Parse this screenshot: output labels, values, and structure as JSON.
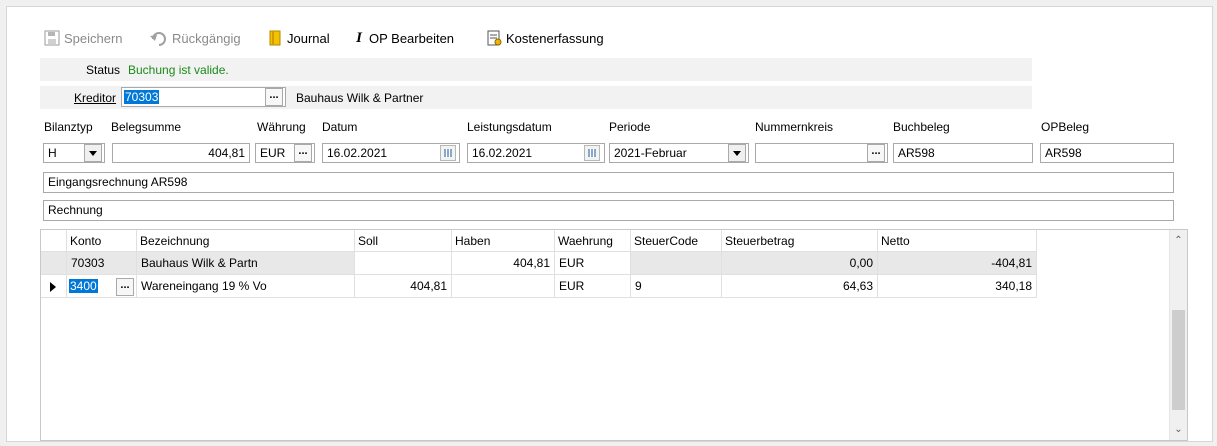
{
  "toolbar": {
    "save_label": "Speichern",
    "undo_label": "Rückgängig",
    "journal_label": "Journal",
    "op_edit_label": "OP Bearbeiten",
    "cost_label": "Kostenerfassung"
  },
  "status": {
    "label": "Status",
    "value": "Buchung ist valide.",
    "value_color": "#1a8a1a"
  },
  "kreditor": {
    "label": "Kreditor",
    "value": "70303",
    "name": "Bauhaus Wilk & Partner",
    "ellipsis": "..."
  },
  "header_fields": {
    "bilanztyp": {
      "label": "Bilanztyp",
      "value": "H"
    },
    "belegsumme": {
      "label": "Belegsumme",
      "value": "404,81"
    },
    "waehrung": {
      "label": "Währung",
      "value": "EUR",
      "ellipsis": "..."
    },
    "datum": {
      "label": "Datum",
      "value": "16.02.2021"
    },
    "leistungsdatum": {
      "label": "Leistungsdatum",
      "value": "16.02.2021"
    },
    "periode": {
      "label": "Periode",
      "value": "2021-Februar"
    },
    "nummernkreis": {
      "label": "Nummernkreis",
      "value": "",
      "ellipsis": "..."
    },
    "buchbeleg": {
      "label": "Buchbeleg",
      "value": "AR598"
    },
    "opbeleg": {
      "label": "OPBeleg",
      "value": "AR598"
    }
  },
  "text1": "Eingangsrechnung AR598",
  "text2": "Rechnung",
  "grid": {
    "columns": [
      "Konto",
      "Bezeichnung",
      "Soll",
      "Haben",
      "Waehrung",
      "SteuerCode",
      "Steuerbetrag",
      "Netto"
    ],
    "rows": [
      {
        "konto": "70303",
        "bezeichnung": "Bauhaus Wilk & Partn",
        "soll": "",
        "haben": "404,81",
        "waehrung": "EUR",
        "steuercode": "",
        "steuerbetrag": "0,00",
        "netto": "-404,81"
      },
      {
        "konto": "3400",
        "bezeichnung": "Wareneingang 19 % Vo",
        "soll": "404,81",
        "haben": "",
        "waehrung": "EUR",
        "steuercode": "9",
        "steuerbetrag": "64,63",
        "netto": "340,18",
        "ellipsis": "..."
      }
    ]
  }
}
